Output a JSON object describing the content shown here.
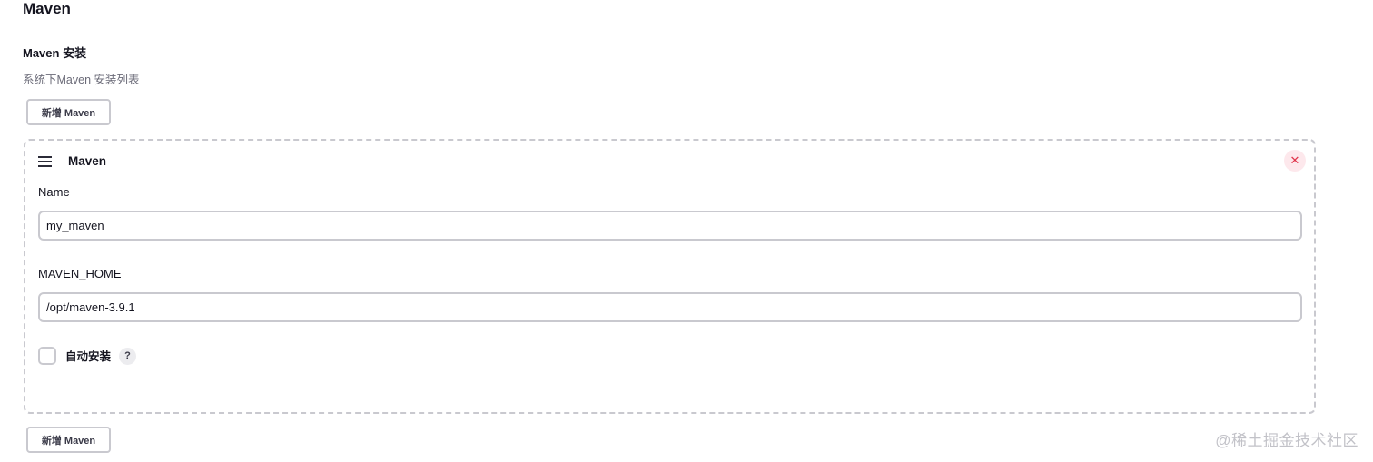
{
  "section": {
    "title": "Maven"
  },
  "installations": {
    "label": "Maven 安装",
    "description": "系统下Maven 安装列表",
    "add_button_label": "新增 Maven",
    "items": [
      {
        "header": "Maven",
        "delete_icon": "close-icon",
        "delete_glyph": "✕",
        "name_label": "Name",
        "name_value": "my_maven",
        "home_label": "MAVEN_HOME",
        "home_value": "/opt/maven-3.9.1",
        "auto_install_label": "自动安装",
        "auto_install_checked": false,
        "help_glyph": "?"
      }
    ]
  },
  "watermark": "@稀土掘金技术社区",
  "colors": {
    "border": "#c9c9cf",
    "delete_bg": "#fde8ec",
    "delete_fg": "#e0334a",
    "muted_text": "#6b6b78"
  }
}
